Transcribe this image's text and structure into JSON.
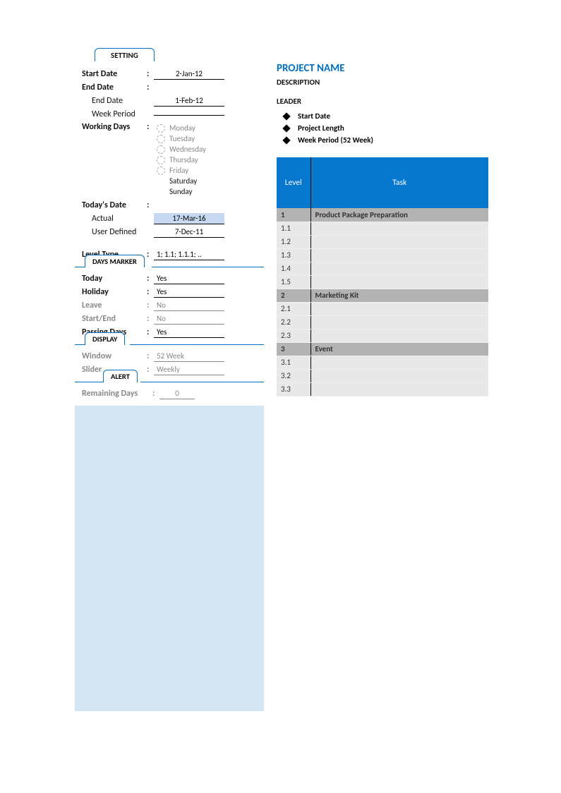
{
  "setting": {
    "tab": "SETTING",
    "start_date_label": "Start Date",
    "start_date": "2-Jan-12",
    "end_date_label": "End Date",
    "end_date_sub_label": "End Date",
    "end_date": "1-Feb-12",
    "week_period_label": "Week Period",
    "week_period": "",
    "working_days_label": "Working Days",
    "days": [
      {
        "name": "Monday",
        "working": true
      },
      {
        "name": "Tuesday",
        "working": true
      },
      {
        "name": "Wednesday",
        "working": true
      },
      {
        "name": "Thursday",
        "working": true
      },
      {
        "name": "Friday",
        "working": true
      },
      {
        "name": "Saturday",
        "working": false
      },
      {
        "name": "Sunday",
        "working": false
      }
    ],
    "todays_date_label": "Today's Date",
    "actual_label": "Actual",
    "actual": "17-Mar-16",
    "user_defined_label": "User Defined",
    "user_defined": "7-Dec-11",
    "level_type_label": "Level Type",
    "level_type": "1; 1.1; 1.1.1; .."
  },
  "days_marker": {
    "tab": "DAYS MARKER",
    "today_label": "Today",
    "today": "Yes",
    "holiday_label": "Holiday",
    "holiday": "Yes",
    "leave_label": "Leave",
    "leave": "No",
    "startend_label": "Start/End",
    "startend": "No",
    "passing_label": "Passing Days",
    "passing": "Yes"
  },
  "display": {
    "tab": "DISPLAY",
    "window_label": "Window",
    "window": "52 Week",
    "slider_label": "Slider",
    "slider": "Weekly"
  },
  "alert": {
    "tab": "ALERT",
    "remaining_label": "Remaining Days",
    "remaining": "0"
  },
  "project": {
    "title": "PROJECT NAME",
    "description": "DESCRIPTION",
    "leader": "LEADER",
    "bullets": [
      "Start Date",
      "Project Length",
      "Week Period (52 Week)"
    ],
    "columns": {
      "level": "Level",
      "task": "Task"
    },
    "rows": [
      {
        "level": "1",
        "task": "Product Package Preparation",
        "header": true
      },
      {
        "level": "1.1",
        "task": ""
      },
      {
        "level": "1.2",
        "task": ""
      },
      {
        "level": "1.3",
        "task": ""
      },
      {
        "level": "1.4",
        "task": ""
      },
      {
        "level": "1.5",
        "task": ""
      },
      {
        "level": "2",
        "task": "Marketing Kit",
        "header": true
      },
      {
        "level": "2.1",
        "task": ""
      },
      {
        "level": "2.2",
        "task": ""
      },
      {
        "level": "2.3",
        "task": ""
      },
      {
        "level": "3",
        "task": "Event",
        "header": true
      },
      {
        "level": "3.1",
        "task": ""
      },
      {
        "level": "3.2",
        "task": ""
      },
      {
        "level": "3.3",
        "task": ""
      }
    ]
  }
}
